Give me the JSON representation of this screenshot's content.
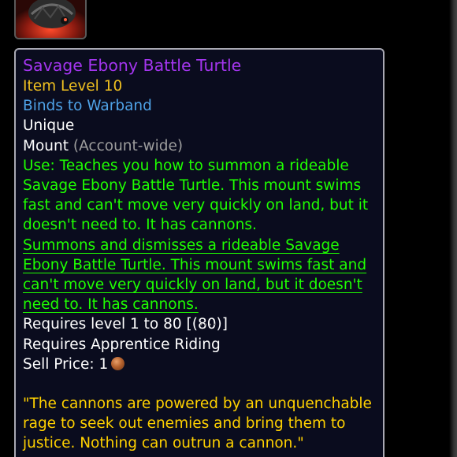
{
  "icon": {
    "name": "turtle-mount-icon"
  },
  "colors": {
    "epic": "#a335ee",
    "item_level": "#f0c020",
    "warband": "#4fa3e8",
    "white": "#ffffff",
    "grey": "#9d9d9d",
    "green": "#1eff00",
    "flavor": "#ffd100"
  },
  "tooltip": {
    "title": "Savage Ebony Battle Turtle",
    "item_level": "Item Level 10",
    "binding": "Binds to Warband",
    "unique": "Unique",
    "mount_type": "Mount",
    "mount_scope": "(Account-wide)",
    "use_lines": [
      "Use: Teaches you how to summon a rideable",
      "Savage Ebony Battle Turtle. This mount swims",
      "fast and can't move very quickly on land, but it",
      "doesn't need to. It has cannons."
    ],
    "spell_lines": [
      "Summons and dismisses a rideable Savage",
      "Ebony Battle Turtle. This mount swims fast and",
      "can't move very quickly on land, but it doesn't",
      "need to. It has cannons."
    ],
    "requires_level_prefix": "Requires level 1 to 80 [(",
    "requires_level_link": "80",
    "requires_level_suffix": ")]",
    "requires_riding": "Requires Apprentice Riding",
    "sell_price_label": "Sell Price: 1",
    "flavor_lines": [
      "\"The cannons are powered by an unquenchable",
      "rage to seek out enemies and bring them to",
      "justice. Nothing can outrun a cannon.\""
    ]
  }
}
